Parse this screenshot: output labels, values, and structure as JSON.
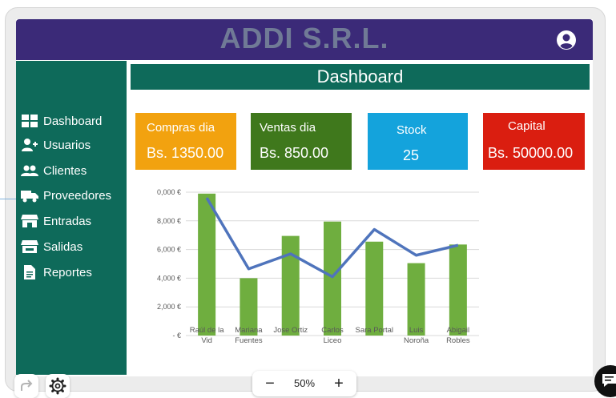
{
  "app": {
    "title": "ADDI S.R.L."
  },
  "user_icon": "account-circle-icon",
  "sidebar": {
    "items": [
      {
        "label": "Dashboard",
        "icon": "grid-icon"
      },
      {
        "label": "Usuarios",
        "icon": "user-plus-icon"
      },
      {
        "label": "Clientes",
        "icon": "users-icon"
      },
      {
        "label": "Proveedores",
        "icon": "truck-icon"
      },
      {
        "label": "Entradas",
        "icon": "store-icon"
      },
      {
        "label": "Salidas",
        "icon": "store-icon"
      },
      {
        "label": "Reportes",
        "icon": "document-icon"
      }
    ]
  },
  "dashboard": {
    "title": "Dashboard"
  },
  "cards": {
    "compras": {
      "label": "Compras dia",
      "value": "Bs.  1350.00",
      "color": "#f2a20f"
    },
    "ventas": {
      "label": "Ventas dia",
      "value": "Bs.  850.00",
      "color": "#3f781c"
    },
    "stock": {
      "label": "Stock",
      "value": "25",
      "color": "#14a3dc"
    },
    "capital": {
      "label": "Capital",
      "value": "Bs.  50000.00",
      "color": "#da1e10"
    }
  },
  "chart_data": {
    "type": "bar",
    "categories": [
      "Raúl de la Vid",
      "Mariana Fuentes",
      "Jose Ortiz",
      "Carlos Liceo",
      "Sara Portal",
      "Luis Noroña",
      "Abigail Robles"
    ],
    "category_lines": [
      [
        "Raúl de la",
        "Vid"
      ],
      [
        "Mariana",
        "Fuentes"
      ],
      [
        "Jose Ortiz"
      ],
      [
        "Carlos",
        "Liceo"
      ],
      [
        "Sara Portal"
      ],
      [
        "Luis",
        "Noroña"
      ],
      [
        "Abigail",
        "Robles"
      ]
    ],
    "series": [
      {
        "type": "bar",
        "values": [
          9900,
          4000,
          6950,
          7950,
          6550,
          5050,
          6350
        ],
        "color": "#6fae3f"
      },
      {
        "type": "line",
        "values": [
          9600,
          4650,
          5700,
          4100,
          7400,
          5600,
          6300
        ],
        "color": "#4f74bc"
      }
    ],
    "yticks": [
      0,
      2000,
      4000,
      6000,
      8000,
      10000
    ],
    "ytick_labels": [
      "-  €",
      "2,000 €",
      "4,000 €",
      "6,000 €",
      "8,000 €",
      "0,000 €"
    ],
    "ylim": [
      0,
      10000
    ],
    "grid": true
  },
  "zoom": {
    "value": "50%",
    "minus": "−",
    "plus": "+"
  },
  "toolbar_icons": {
    "redo": "redo-icon",
    "settings": "gear-icon",
    "chat": "chat-icon"
  }
}
